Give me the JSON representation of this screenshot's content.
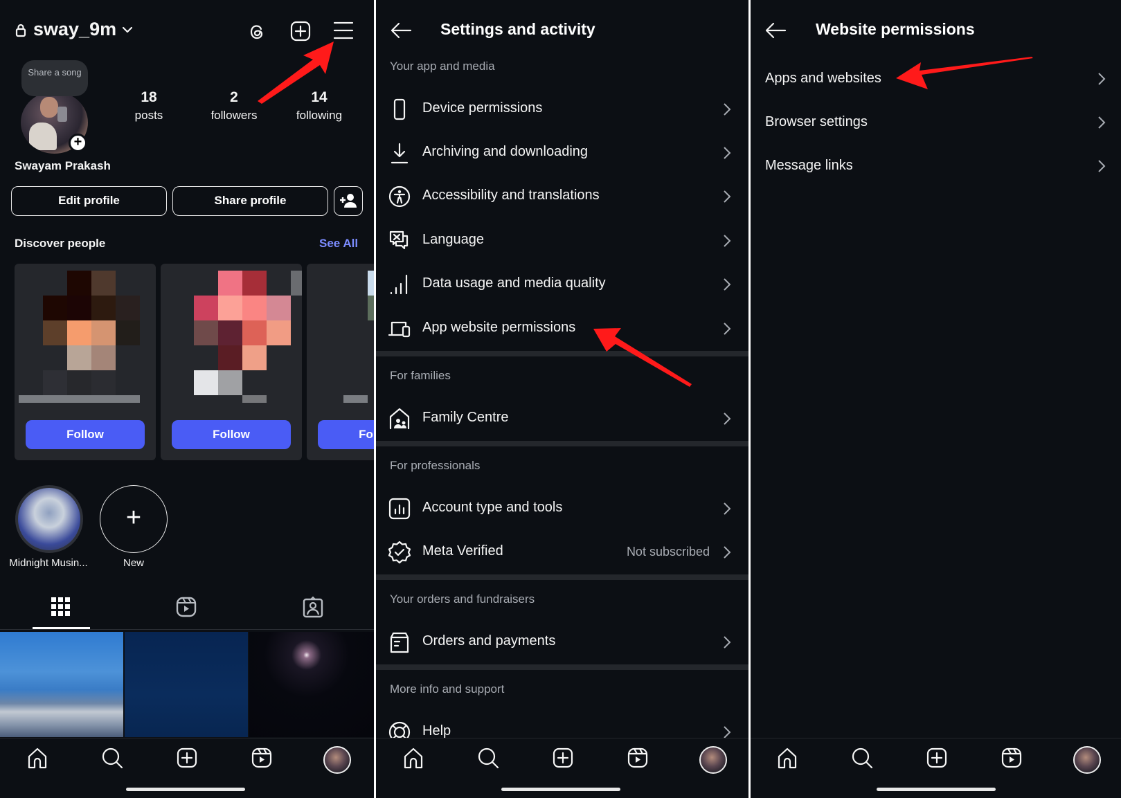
{
  "colors": {
    "background": "#0c0f14",
    "accent_button": "#4a5cf5",
    "link": "#7c8cff",
    "annotation_arrow": "#ff1a1a",
    "secondary_text": "#a8acb3"
  },
  "profile_screen": {
    "header": {
      "lock_icon": "lock-icon",
      "username": "sway_9m",
      "icons": [
        "threads-icon",
        "create-icon",
        "menu-icon"
      ]
    },
    "note_bubble": "Share a song",
    "stats": [
      {
        "value": "18",
        "label": "posts"
      },
      {
        "value": "2",
        "label": "followers"
      },
      {
        "value": "14",
        "label": "following"
      }
    ],
    "full_name": "Swayam Prakash",
    "buttons": {
      "edit_profile": "Edit profile",
      "share_profile": "Share profile",
      "add_person_icon": "person-add-icon"
    },
    "discover": {
      "title": "Discover people",
      "see_all": "See All",
      "cards": [
        {
          "follow_label": "Follow"
        },
        {
          "follow_label": "Follow"
        },
        {
          "follow_label": "Follow"
        }
      ]
    },
    "highlights": [
      {
        "label": "Midnight Musin..."
      },
      {
        "label": "New"
      }
    ],
    "tabs": [
      "grid-icon",
      "reels-icon",
      "tagged-icon"
    ],
    "active_tab": "grid"
  },
  "settings_screen": {
    "title": "Settings and activity",
    "sections": [
      {
        "header": "Your app and media",
        "items": [
          {
            "label": "Device permissions",
            "icon": "phone-icon"
          },
          {
            "label": "Archiving and downloading",
            "icon": "download-icon"
          },
          {
            "label": "Accessibility and translations",
            "icon": "accessibility-icon"
          },
          {
            "label": "Language",
            "icon": "language-icon"
          },
          {
            "label": "Data usage and media quality",
            "icon": "signal-icon"
          },
          {
            "label": "App website permissions",
            "icon": "devices-icon"
          }
        ]
      },
      {
        "header": "For families",
        "items": [
          {
            "label": "Family Centre",
            "icon": "family-home-icon"
          }
        ]
      },
      {
        "header": "For professionals",
        "items": [
          {
            "label": "Account type and tools",
            "icon": "chart-icon"
          },
          {
            "label": "Meta Verified",
            "icon": "verified-badge-icon",
            "value": "Not subscribed"
          }
        ]
      },
      {
        "header": "Your orders and fundraisers",
        "items": [
          {
            "label": "Orders and payments",
            "icon": "orders-icon"
          }
        ]
      },
      {
        "header": "More info and support",
        "items": [
          {
            "label": "Help",
            "icon": "lifebuoy-icon"
          }
        ]
      }
    ]
  },
  "website_permissions_screen": {
    "title": "Website permissions",
    "items": [
      {
        "label": "Apps and websites"
      },
      {
        "label": "Browser settings"
      },
      {
        "label": "Message links"
      }
    ]
  },
  "bottom_nav": [
    "home-icon",
    "search-icon",
    "create-icon",
    "reels-icon",
    "profile-avatar"
  ]
}
